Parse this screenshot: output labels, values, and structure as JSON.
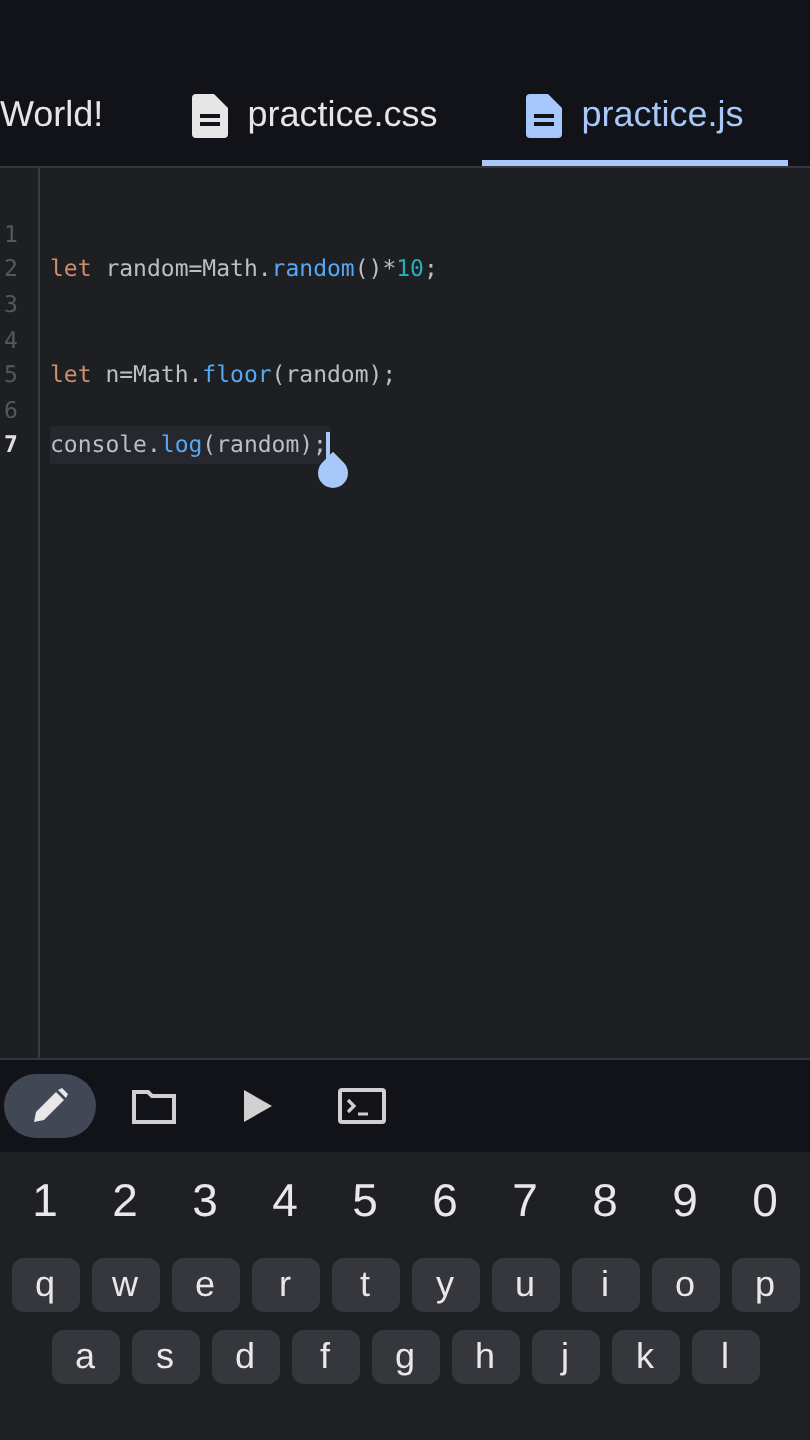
{
  "tabs": [
    {
      "label": "World!",
      "icon": false,
      "selected": false
    },
    {
      "label": "practice.css",
      "icon": true,
      "selected": false
    },
    {
      "label": "practice.js",
      "icon": true,
      "selected": true
    }
  ],
  "editor": {
    "lines": [
      {
        "number": "1",
        "current": false
      },
      {
        "number": "2",
        "current": false,
        "tokens": [
          {
            "text": "let",
            "kind": "keyword"
          },
          {
            "text": " random=Math.",
            "kind": "plain"
          },
          {
            "text": "random",
            "kind": "method"
          },
          {
            "text": "()*",
            "kind": "plain"
          },
          {
            "text": "10",
            "kind": "number"
          },
          {
            "text": ";",
            "kind": "plain"
          }
        ]
      },
      {
        "number": "3",
        "current": false
      },
      {
        "number": "4",
        "current": false
      },
      {
        "number": "5",
        "current": false,
        "tokens": [
          {
            "text": "let",
            "kind": "keyword"
          },
          {
            "text": " n=Math.",
            "kind": "plain"
          },
          {
            "text": "floor",
            "kind": "method"
          },
          {
            "text": "(random);",
            "kind": "plain"
          }
        ]
      },
      {
        "number": "6",
        "current": false
      },
      {
        "number": "7",
        "current": true,
        "tokens": [
          {
            "text": "console.",
            "kind": "plain"
          },
          {
            "text": "log",
            "kind": "method"
          },
          {
            "text": "(random);",
            "kind": "plain"
          }
        ]
      }
    ]
  },
  "toolbar": [
    {
      "kind": "edit",
      "selected": true
    },
    {
      "kind": "folder",
      "selected": false
    },
    {
      "kind": "run",
      "selected": false
    },
    {
      "kind": "terminal",
      "selected": false
    }
  ],
  "keyboard": {
    "rows": [
      {
        "kind": "plain",
        "keys": [
          "1",
          "2",
          "3",
          "4",
          "5",
          "6",
          "7",
          "8",
          "9",
          "0"
        ]
      },
      {
        "kind": "keys",
        "keys": [
          "q",
          "w",
          "e",
          "r",
          "t",
          "y",
          "u",
          "i",
          "o",
          "p"
        ]
      },
      {
        "kind": "keys",
        "keys": [
          "a",
          "s",
          "d",
          "f",
          "g",
          "h",
          "j",
          "k",
          "l"
        ]
      }
    ]
  }
}
